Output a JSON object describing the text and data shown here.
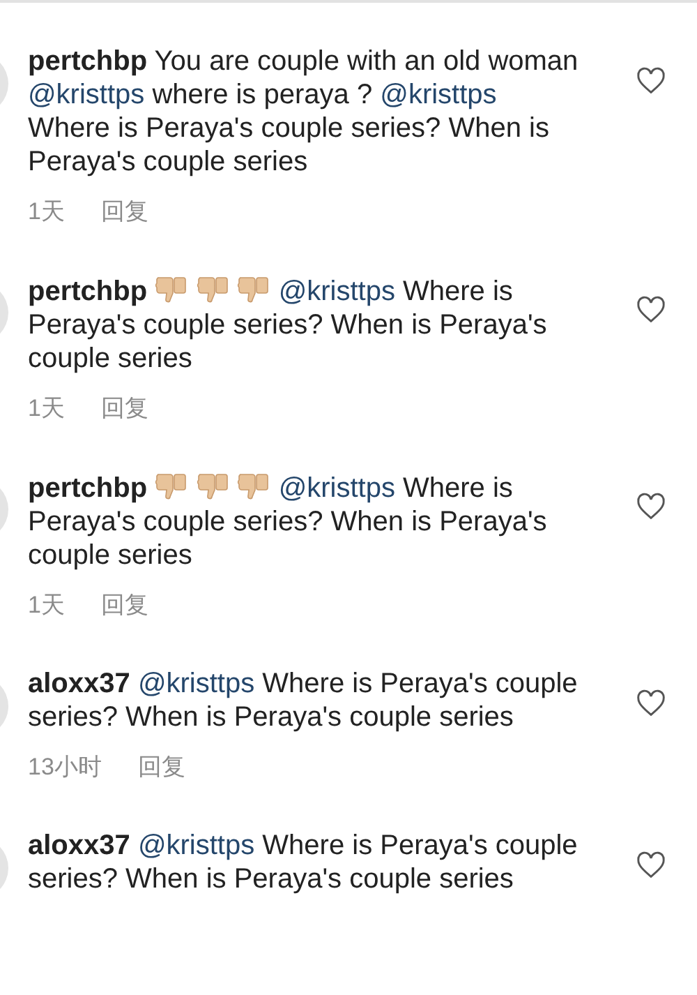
{
  "comments": [
    {
      "user": "pertchbp",
      "parts": [
        {
          "kind": "text",
          "text": "You are couple with an old woman"
        },
        {
          "kind": "mention",
          "text": "@kristtps"
        },
        {
          "kind": "text",
          "text": " where is peraya ?"
        },
        {
          "kind": "mention",
          "text": "@kristtps"
        },
        {
          "kind": "text",
          "text": "Where is Peraya's couple series? When is Peraya's couple series"
        }
      ],
      "time": "1天",
      "reply": "回复"
    },
    {
      "user": "pertchbp",
      "parts": [
        {
          "kind": "thumbs_down"
        },
        {
          "kind": "thumbs_down"
        },
        {
          "kind": "thumbs_down"
        },
        {
          "kind": "mention",
          "text": "@kristtps"
        },
        {
          "kind": "text",
          "text": "Where is Peraya's couple series? When is Peraya's couple series"
        }
      ],
      "time": "1天",
      "reply": "回复"
    },
    {
      "user": "pertchbp",
      "parts": [
        {
          "kind": "thumbs_down"
        },
        {
          "kind": "thumbs_down"
        },
        {
          "kind": "thumbs_down"
        },
        {
          "kind": "mention",
          "text": "@kristtps"
        },
        {
          "kind": "text",
          "text": "Where is Peraya's couple series? When is Peraya's couple series"
        }
      ],
      "time": "1天",
      "reply": "回复"
    },
    {
      "user": "aloxx37",
      "parts": [
        {
          "kind": "mention",
          "text": "@kristtps"
        },
        {
          "kind": "text",
          "text": "Where is Peraya's couple series? When is Peraya's couple series"
        }
      ],
      "time": "13小时",
      "reply": "回复"
    },
    {
      "user": "aloxx37",
      "parts": [
        {
          "kind": "mention",
          "text": "@kristtps"
        },
        {
          "kind": "text",
          "text": "Where is Peraya's couple series? When is Peraya's couple series"
        }
      ]
    }
  ]
}
